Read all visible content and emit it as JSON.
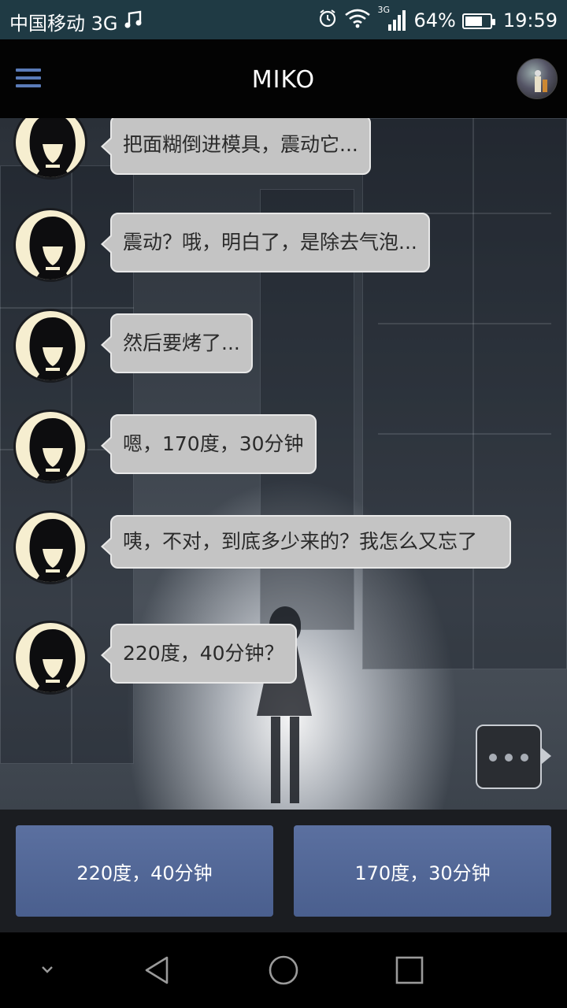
{
  "status_bar": {
    "carrier": "中国移动 3G",
    "network_label": "3G",
    "battery_percent": "64%",
    "battery_level": 0.64,
    "time": "19:59",
    "icons": [
      "music-icon",
      "alarm-icon",
      "wifi-icon",
      "signal-icon",
      "battery-icon"
    ]
  },
  "app_bar": {
    "title": "MIKO",
    "menu_icon": "hamburger-menu-icon",
    "profile_icon": "profile-avatar"
  },
  "messages": [
    {
      "text": "把面糊倒进模具，震动它..."
    },
    {
      "text": "震动？哦，明白了，是除去气泡..."
    },
    {
      "text": "然后要烤了..."
    },
    {
      "text": "嗯，170度，30分钟"
    },
    {
      "text": "咦，不对，到底多少来的？我怎么又忘了"
    },
    {
      "text": "220度，40分钟？"
    }
  ],
  "typing_indicator": "typing-dots-icon",
  "choices": [
    {
      "label": "220度，40分钟"
    },
    {
      "label": "170度，30分钟"
    }
  ],
  "nav_bar": {
    "icons": [
      "chevron-down-icon",
      "back-icon",
      "home-icon",
      "recents-icon"
    ]
  },
  "colors": {
    "status_bar_bg": "#1f3a44",
    "app_bar_bg": "#030303",
    "menu_icon": "#5a7bb8",
    "bubble_bg": "#c4c4c4",
    "choice_button": "#5268990"
  }
}
